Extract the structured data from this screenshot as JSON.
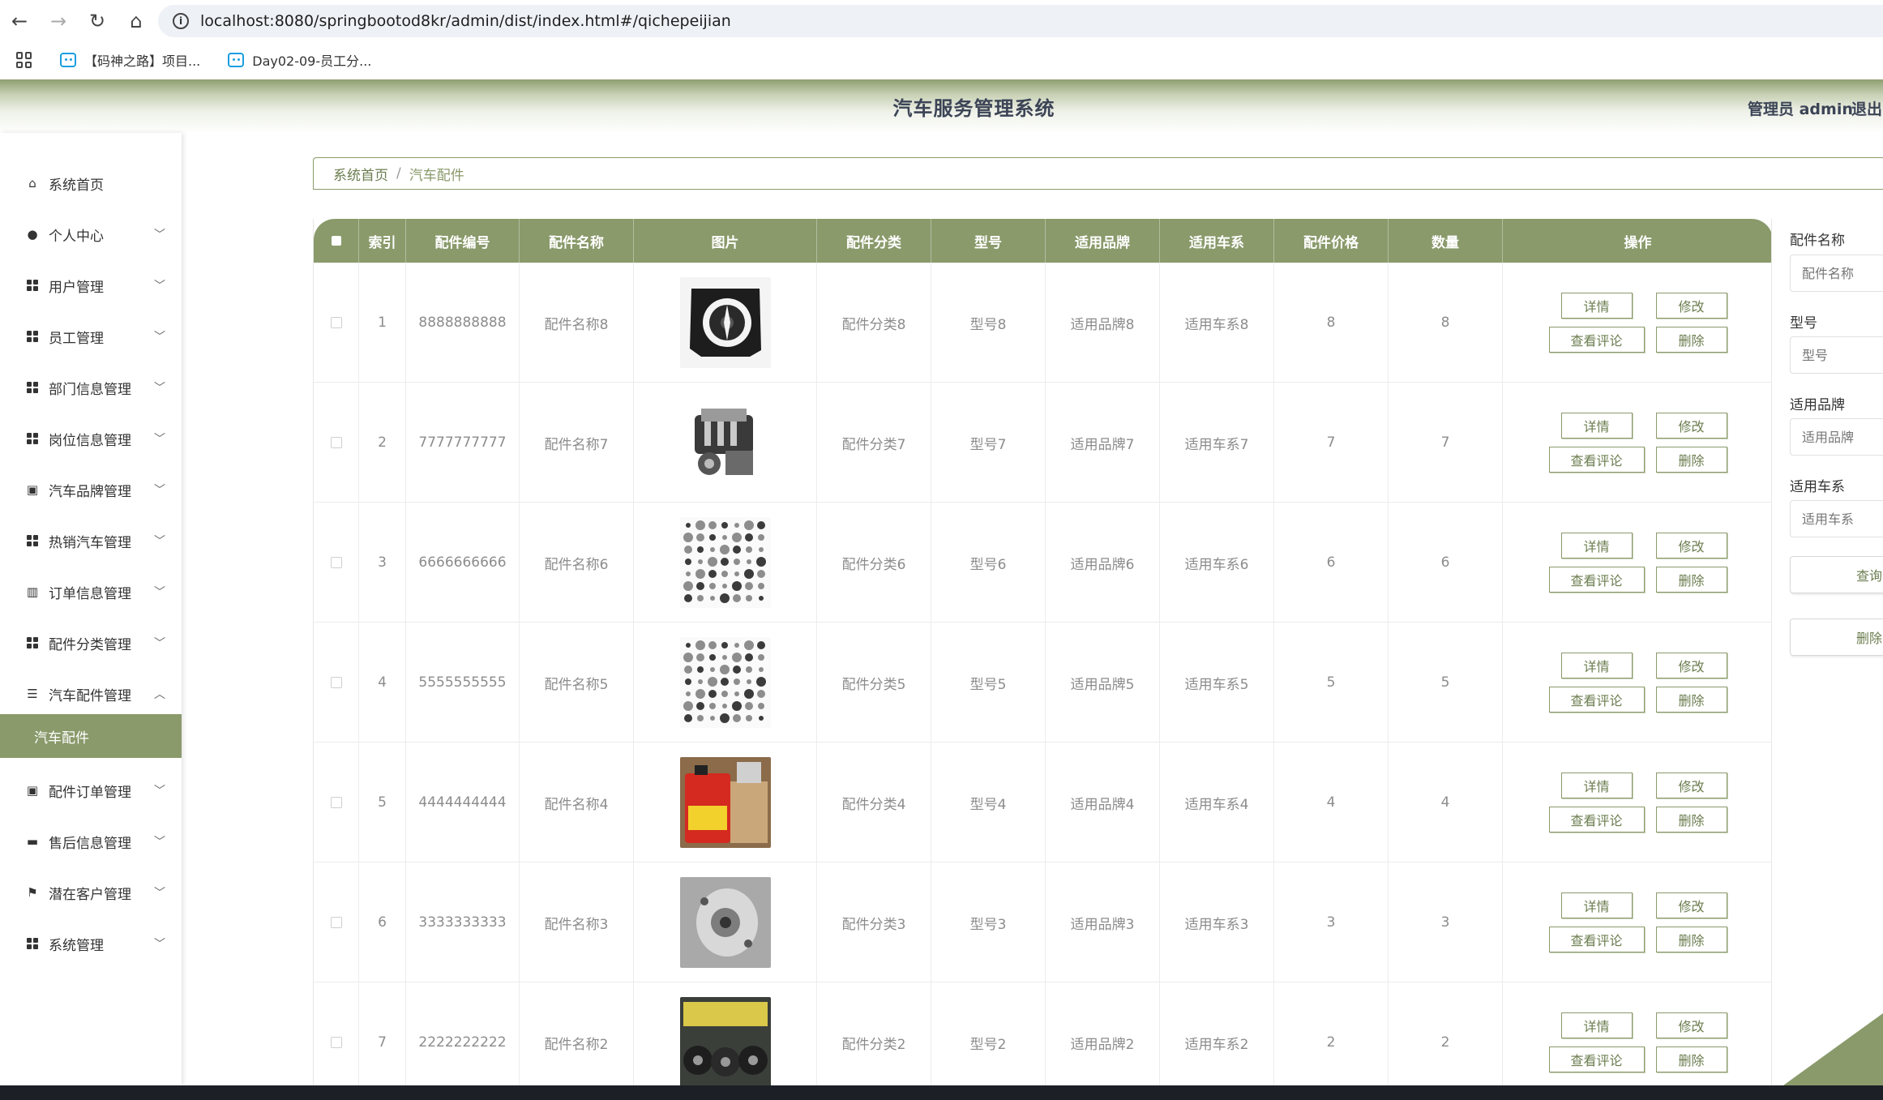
{
  "browser": {
    "url": "localhost:8080/springbootod8kr/admin/dist/index.html#/qichepeijian",
    "bookmarks": [
      "【码神之路】项目...",
      "Day02-09-员工分..."
    ]
  },
  "header": {
    "title": "汽车服务管理系统",
    "user": "管理员 admin",
    "logout": "退出"
  },
  "sidebar": {
    "items": [
      {
        "label": "系统首页",
        "icon": "home-icon",
        "chevron": ""
      },
      {
        "label": "个人中心",
        "icon": "user-icon",
        "chevron": "﹀"
      },
      {
        "label": "用户管理",
        "icon": "grid-icon",
        "chevron": "﹀"
      },
      {
        "label": "员工管理",
        "icon": "grid-icon",
        "chevron": "﹀"
      },
      {
        "label": "部门信息管理",
        "icon": "grid-icon",
        "chevron": "﹀"
      },
      {
        "label": "岗位信息管理",
        "icon": "grid-icon",
        "chevron": "﹀"
      },
      {
        "label": "汽车品牌管理",
        "icon": "clipboard-icon",
        "chevron": "﹀"
      },
      {
        "label": "热销汽车管理",
        "icon": "grid-icon",
        "chevron": "﹀"
      },
      {
        "label": "订单信息管理",
        "icon": "bar-chart-icon",
        "chevron": "﹀"
      },
      {
        "label": "配件分类管理",
        "icon": "grid-icon",
        "chevron": "﹀"
      },
      {
        "label": "汽车配件管理",
        "icon": "list-icon",
        "chevron": "︿"
      },
      {
        "label": "配件订单管理",
        "icon": "clipboard-icon",
        "chevron": "﹀"
      },
      {
        "label": "售后信息管理",
        "icon": "printer-icon",
        "chevron": "﹀"
      },
      {
        "label": "潜在客户管理",
        "icon": "flag-icon",
        "chevron": "﹀"
      },
      {
        "label": "系统管理",
        "icon": "grid-icon",
        "chevron": "﹀"
      }
    ],
    "active_sub": "汽车配件"
  },
  "breadcrumb": {
    "home": "系统首页",
    "separator": "/",
    "current": "汽车配件"
  },
  "table": {
    "columns": [
      "索引",
      "配件编号",
      "配件名称",
      "图片",
      "配件分类",
      "型号",
      "适用品牌",
      "适用车系",
      "配件价格",
      "数量",
      "操作"
    ],
    "buttons": {
      "detail": "详情",
      "edit": "修改",
      "review": "查看评论",
      "delete": "删除"
    },
    "rows": [
      {
        "index": "1",
        "code": "8888888888",
        "name": "配件名称8",
        "category": "配件分类8",
        "model": "型号8",
        "brand": "适用品牌8",
        "series": "适用车系8",
        "price": "8",
        "qty": "8",
        "image": "fan-shroud"
      },
      {
        "index": "2",
        "code": "7777777777",
        "name": "配件名称7",
        "category": "配件分类7",
        "model": "型号7",
        "brand": "适用品牌7",
        "series": "适用车系7",
        "price": "7",
        "qty": "7",
        "image": "engine"
      },
      {
        "index": "3",
        "code": "6666666666",
        "name": "配件名称6",
        "category": "配件分类6",
        "model": "型号6",
        "brand": "适用品牌6",
        "series": "适用车系6",
        "price": "6",
        "qty": "6",
        "image": "parts"
      },
      {
        "index": "4",
        "code": "5555555555",
        "name": "配件名称5",
        "category": "配件分类5",
        "model": "型号5",
        "brand": "适用品牌5",
        "series": "适用车系5",
        "price": "5",
        "qty": "5",
        "image": "parts"
      },
      {
        "index": "5",
        "code": "4444444444",
        "name": "配件名称4",
        "category": "配件分类4",
        "model": "型号4",
        "brand": "适用品牌4",
        "series": "适用车系4",
        "price": "4",
        "qty": "4",
        "image": "oil"
      },
      {
        "index": "6",
        "code": "3333333333",
        "name": "配件名称3",
        "category": "配件分类3",
        "model": "型号3",
        "brand": "适用品牌3",
        "series": "适用车系3",
        "price": "3",
        "qty": "3",
        "image": "pump"
      },
      {
        "index": "7",
        "code": "2222222222",
        "name": "配件名称2",
        "category": "配件分类2",
        "model": "型号2",
        "brand": "适用品牌2",
        "series": "适用车系2",
        "price": "2",
        "qty": "2",
        "image": "filters"
      }
    ]
  },
  "search": {
    "fields": [
      {
        "label": "配件名称",
        "placeholder": "配件名称"
      },
      {
        "label": "型号",
        "placeholder": "型号"
      },
      {
        "label": "适用品牌",
        "placeholder": "适用品牌"
      },
      {
        "label": "适用车系",
        "placeholder": "适用车系"
      }
    ],
    "query_button": "查询",
    "delete_button": "删除"
  },
  "colors": {
    "accent": "#8a9a6b",
    "header_text": "#3c4456"
  }
}
